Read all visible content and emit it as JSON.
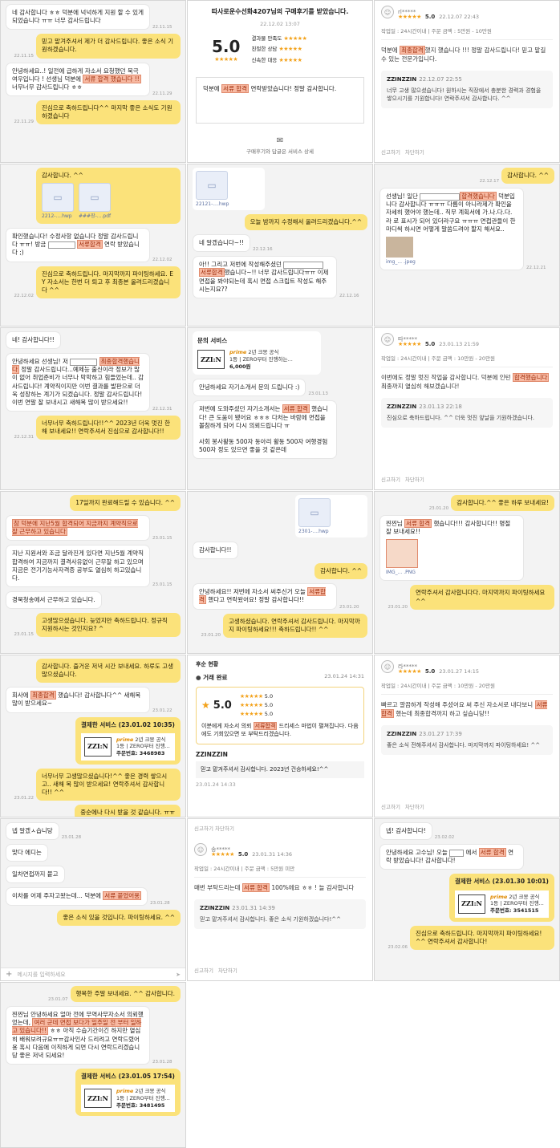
{
  "t1": {
    "b1": "네 감사합니다 ㅎㅎ 덕분에 넉넉하게 지원 할 수 있게 되었습니다 ㅠㅠ 너무 감사드립니다",
    "b2": "믿고 맡겨주셔서 제가 더 감사드립니다. 좋은 소식 기원하겠습니다.",
    "b3a": "안녕하세요..! 일전에 급하게 자소서 요청했던 북극여우입니다 ! 선생님 덕분에 ",
    "b3h": "서류 합격 했습니다 !!",
    "b3b": " 너무너무 감사드립니다 ㅎㅎ",
    "b4": "진심으로 축하드립니다^^ 마지막 좋은 소식도 기원하겠습니다",
    "times": [
      "22.11.15",
      "22.11.15",
      "22.11.29",
      "22.11.29"
    ]
  },
  "t2": {
    "banner": "따사로운수선화4207님의 구매후기를 받았습니다.",
    "date": "22.12.02 13:07",
    "score": "5.0",
    "rows": [
      "결과물 만족도",
      "친절한 상담",
      "신속한 대응"
    ],
    "body_a": "덕분에 ",
    "body_h": "서류 합격",
    "body_b": " 연락받았습니다! 정말 감사합니다.",
    "footer": "구매후기와 답글은 서비스 상세"
  },
  "t3": {
    "user": "rl*****",
    "score": "5.0",
    "date": "22.12.07 22:43",
    "meta": "작업일 : 24시간이내 | 주문 금액 : 5만원 - 10만원",
    "body_a": "덕분에 ",
    "body_h": "최종합격",
    "body_b": "했지 했습니다 !!! 정말 감사드립니다! 믿고 맡길 수 있는 전문가입니다.",
    "reply_name": "ZZINZZIN",
    "reply_date": "22.12.07 22:55",
    "reply_body": "너무 고생 많으셨습니다! 원하시는 직장에서 충분한 경력과 경험을 쌓으시기를 기원합니다! 연락주셔서 감사합니다. ^^",
    "foot": [
      "신고하기",
      "차단하기"
    ]
  },
  "t4": {
    "b1": "감사합니다. ^^",
    "files": [
      "2212-....hwp",
      "###장-....pdf"
    ],
    "b2a": "확인했습니다! 수정사항 없습니다 정말 감사드립니다 ㅠㅠ! 방금 ",
    "b2h": "서류합격",
    "b2b": " 연락 받았습니다 ;)",
    "b3": "진심으로 축하드립니다. 마지막까지 파이팅하세요. EY 자소서는 한번 더 퇴고 후 최종본 올려드리겠습니다 ^^",
    "times": [
      "22.12.02",
      "22.12.02"
    ]
  },
  "t5": {
    "file": "22121-....hwp",
    "b1": "오늘 밤까지 수정해서 올려드리겠습니다.^^",
    "b2": "네 알겠습니다~!!",
    "b3a": "아!! 그리고 저번에 작성해주셨던 ",
    "b3h": "서류합격",
    "b3b": "했습니다~!! 너무 감사드립니다ㅠㅠ 이제 면접을 봐야되는데 혹시 면접 스크립트 작성도 해주시는지요??",
    "times": [
      "22.12.16",
      "22.12.16"
    ]
  },
  "t6": {
    "b1": "감사합니다. ^^",
    "b2a": "선생님! 일단 ",
    "b2h": "합격했습니다",
    "b2b": " 덕분입니다 감사합니다 ㅠㅠㅠ 다름이 아니라제가 확인을 자세히 했어야 했는데.. 직무 계획서에 가.나.다.다.라 로 표시가 되어 있더라구요 ㅠㅠㅠ 면접관들이 한마디씩 하시면 어떻게 말씀드려야 할지 해서요..",
    "img": "img_... .jpeg",
    "times": [
      "22.12.17",
      "22.12.21"
    ]
  },
  "t7": {
    "b1": "네! 감사합니다!!",
    "b2a": "안녕하세요 선생님! 저 ",
    "b2h": "최종합격했습니다",
    "b2b": " 정말 감사드립니다...예체능 출신이라 정보가 많이 없어 취업준비가 너무나 막막하고 힘들었는데.. 감사드립니다! 계약직이지만 이번 결과를 발판으로 더욱 성장하는 계기가 되겠습니다. 정말 감사드립니다! 이번 연말 잘 보내시고 새해복 많이 받으세요!!",
    "b3": "너무너무 축하드립니다!!^^ 2023년 더욱 멋진 한 해 보내세요!! 연락주셔서 진심으로 감사합니다!!",
    "times": [
      "22.12.31",
      "22.12.31"
    ]
  },
  "t8": {
    "svc_title": "문의 서비스",
    "svc_line1": "prime",
    "svc_line1b": " 2년 크몽 공식",
    "svc_line2": "1등 | ZERO부터 진행하는...",
    "svc_price": "6,000원",
    "b1": "안녕하세요 자기소개서 문의 드립니다 :)",
    "b2a": "저번에 도와주셨던 자기소개서는 ",
    "b2h": "서류 합격",
    "b2b": " 했습니다! 큰 도움이 됐어요 ㅎㅎㅎ 다처는 바람에 면접을 볼참하게 되어 다시 의뢰드립니다 ㅠ",
    "b3": "사회 봉사활동 500자 동아리 활동 500자 여행경험 500자 정도 있으면 좋을 것 같은데",
    "times": [
      "23.01.13",
      "23.01.13"
    ]
  },
  "t9": {
    "user": "따*****",
    "score": "5.0",
    "date": "23.01.13 21:59",
    "meta": "작업일 : 24시간이내 | 주문 금액 : 10만원 - 20만원",
    "body_a": "이번에도 정말 멋진 작업을 감사합니다. 덕분에 인턴 ",
    "body_h": "합격했습니다",
    "body_b": " 최종까지 열심히 해보겠습니다!",
    "reply_name": "ZZINZZIN",
    "reply_date": "23.01.13 22:18",
    "reply_body": "진심으로 축하드립니다. ^^ 더욱 멋진 앞날을 기원하겠습니다.",
    "foot": [
      "신고하기",
      "차단하기"
    ]
  },
  "t10": {
    "b0": "17일까지 완료해드릴 수 있습니다. ^^",
    "b1h": "참 덕분에 지난5월 합격되어 지금까지 계약직으로 잘 근무하고 있습니다",
    "b2": "지난 지원서와 조금 달라진게 있다면 지난5월 계약직 합격하여 지금까지 결격사유없이 근무잘 하고 있으며 지금은 전기기능사자격증 공부도 열심히 하고있습니다.",
    "b3": "경북청송에서 근무하고 있습니다.",
    "b4": "고생많으셨습니다. 늦었지만 축하드립니다. 정규직 지원하시는 것인지요? ^",
    "times": [
      "23.01.15",
      "23.01.15",
      "23.01.15"
    ]
  },
  "t11": {
    "file": "2301-....hwp",
    "b1": "감사합니다!!",
    "b2": "감사합니다. ^^",
    "b3a": "안녕하세요!! 저번에 자소서 써주신거 오늘 ",
    "b3h": "서류합격",
    "b3b": " 했다고 연락왔어요! 정말 감사합니다!!",
    "b4": "고생하셨습니다. 연락주셔서 감사드립니다. 마지막까지 파이팅하세요!!! 축하드립니다!! ^^",
    "times": [
      "23.01.20",
      "23.01.20"
    ]
  },
  "t12": {
    "b1": "감사합니다.^^ 좋은 하루 보내세요!",
    "b2a": "찐찐님 ",
    "b2h": "서류 합격",
    "b2b": " 했습니다!!! 감사합니다!! 명절 잘 보내세요!!",
    "img": "IMG_... .PNG",
    "b3": "연락주셔서 감사합니다다. 마지막까지 파이팅하세요^^",
    "times": [
      "23.01.20",
      "23.01.20"
    ]
  },
  "t13": {
    "b1": "감사합니다. 즐거운 저녁 시간 보내세요. 하루도 고생 많으셨습니다.",
    "b2a": "회사에 ",
    "b2h": "최종합격",
    "b2b": " 했습니다! 감사합니다^^ 새해복 많이 받으세요~",
    "svc_title": "결제한 서비스 (23.01.02 10:35)",
    "svc_line1": "prime",
    "svc_line1b": " 2년 크몽 공식",
    "svc_line2": "1등 | ZERO부터 진행...",
    "svc_order": "주문번호: 3468983",
    "b3": "너무너무 고생많으셨습니다!^^ 좋은 경력 쌓으시고.. 새해 복 많이 받으세요! 연락주셔서 감사합니다!! ^^",
    "b4": "중순에나 다시 받을 것 같습니다. ㅠㅠ",
    "times": [
      "23.01.22",
      "23.01.22"
    ]
  },
  "t14": {
    "section": "거래 완료",
    "date": "23.01.24 14:31",
    "score": "5.0",
    "sub": [
      "5.0",
      "5.0",
      "5.0"
    ],
    "body_a": "이분에게 자소서 의뢰 ",
    "body_h": "서류합격",
    "body_b": " 드리세스 마법이 펼쳐집니다. 다음에도 기회있으면 또 부탁드리겠습니다.",
    "reply_name": "ZZINZZIN",
    "reply_body": "믿고 맡겨주셔서 감사합니다. 2023년 건승하세요!^^",
    "reply_date": "23.01.24 14:33",
    "top": "후순 현황"
  },
  "t15": {
    "user": "라*****",
    "score": "5.0",
    "date": "23.01.27 14:15",
    "meta": "작업일 : 24시간이내 | 주문 금액 : 10만원 - 20만원",
    "body_a": "빠르고 깔끔하게 작성해 주셨어요 써 주신 자소서로 내다보니 ",
    "body_h": "서류 합격",
    "body_b": " 했는데 최종합격까지 하고 싶습니당!!",
    "reply_name": "ZZINZZIN",
    "reply_date": "23.01.27 17:39",
    "reply_body": "좋은 소식 전해주셔서 감사합니다. 마지막까지 파이팅하세요! ^^",
    "foot": [
      "신고하기",
      "차단하기"
    ]
  },
  "t16": {
    "b1": "넵 알겠ㅅ습니당",
    "b2": "맞다 에디는",
    "b3": "일차면접까지 붙고",
    "b4a": "이차를 어제 주자고왔는데... 덕분에 ",
    "b4h": "서류 붙었어용",
    "b5": "좋은 소식 있을 것입니다. 파이팅하세요. ^^",
    "input_ph": "메시지를 입력하세요",
    "times": [
      "23.01.28",
      "23.01.28"
    ]
  },
  "t17": {
    "top": [
      "신고하기",
      "차단하기"
    ],
    "user": "송*****",
    "score": "5.0",
    "date": "23.01.31 14:36",
    "meta": "작업일 : 24시간이내 | 주문 금액 : 5만원 미만",
    "body_a": "매번 부탁드리는데 ",
    "body_h": "서류 합격",
    "body_b": " 100%에요 ㅎㅎ ! 늘 감사합니다",
    "reply_name": "ZZINZZIN",
    "reply_date": "23.01.31 14:39",
    "reply_body": "믿고 맡겨주셔서 감사합니다. 좋은 소식 기원하겠습니다!^^",
    "foot": [
      "신고하기",
      "차단하기"
    ]
  },
  "t18": {
    "b1": "넵! 감사합니다!",
    "b2a": "안녕하세요 고수님! 오늘 ",
    "b2b": " 에서 ",
    "b2h": "서류 합격",
    "b2c": " 연락 받았습니다! 감사합니다!",
    "svc_title": "결제한 서비스 (23.01.30 10:01)",
    "svc_line1": "prime",
    "svc_line1b": " 2년 크몽 공식",
    "svc_line2": "1등 | ZERO부터 진행...",
    "svc_order": "주문번호: 3541515",
    "b3": "진심으로 축하드립니다. 마지막까지 파이팅하세요! ^^ 연락주셔서 감사합니다!",
    "times": [
      "23.02.02",
      "23.02.06"
    ]
  },
  "t19": {
    "b1": "행복한 주말 보내세요. ^^ 감사합니다.",
    "b2a": "찐찐님 안녕하세요 얼마 전에 무역사무자소서 의뢰했었는데, ",
    "b2h": "여러 군데 면접 보다가 일주일 전 부터 일하고 있습니다!!",
    "b2b": " ㅎㅎ 아직 수습기간이긴 하지만 열심히 배워보려규요ㅠㅠ감사인사 드리려고 연락드렸어용 혹시 다음에 이직하게 되면 다시 연락드리겠습니당 좋은 저녁 되세요!",
    "svc_title": "결제한 서비스 (23.01.05 17:54)",
    "svc_line1": "prime",
    "svc_line1b": " 2년 크몽 공식",
    "svc_line2": "1등 | ZERO부터 진행...",
    "svc_order": "주문번호: 3481495",
    "times": [
      "23.01.07",
      "23.01.28"
    ]
  },
  "logo": "ZZI:N",
  "colors": {
    "yellow": "#fbe27a",
    "highlight": "#f7b9a2",
    "star": "#f3a21b"
  }
}
